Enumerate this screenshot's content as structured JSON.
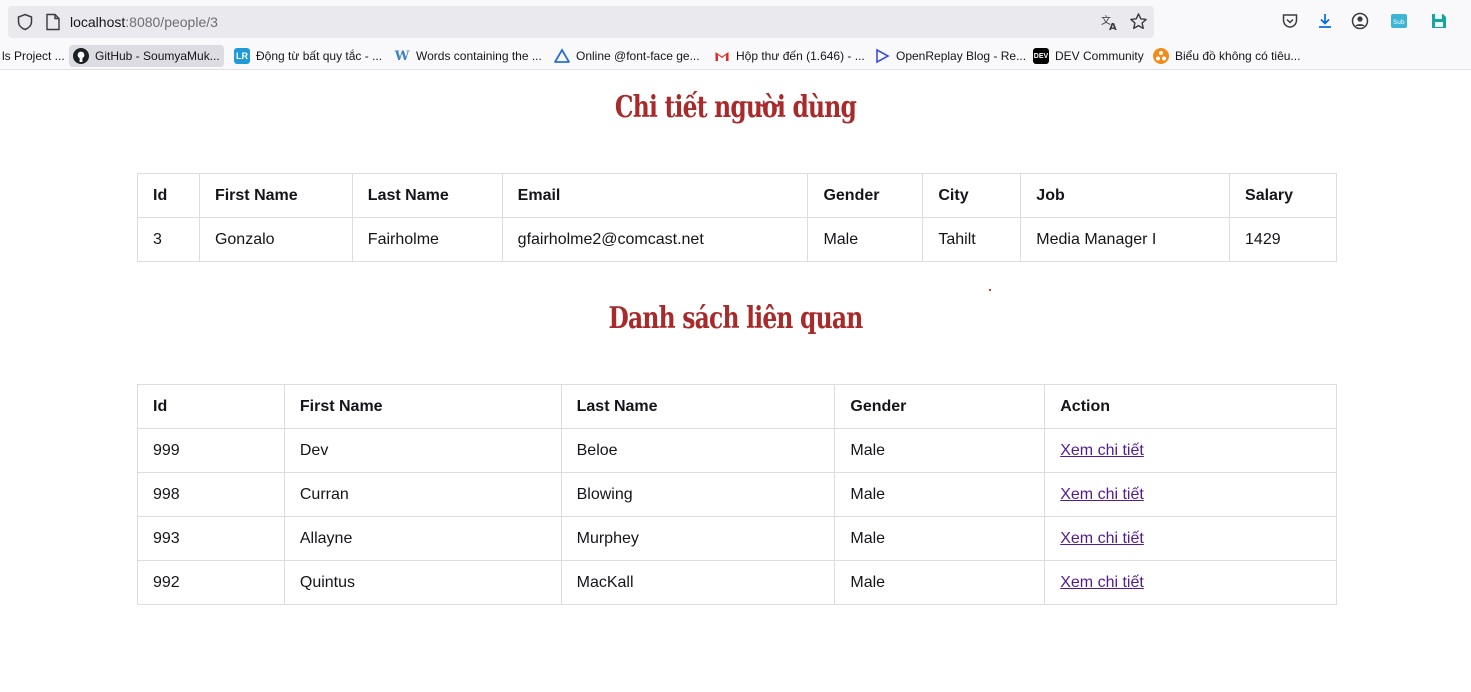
{
  "browser": {
    "url_host": "localhost",
    "url_path": ":8080/people/3",
    "bookmarks": [
      {
        "label": "ls Project ...",
        "icon": "project-icon"
      },
      {
        "label": "GitHub - SoumyaMuk...",
        "icon": "github-icon"
      },
      {
        "label": "Động từ bất quy tắc - ...",
        "icon": "lr-icon"
      },
      {
        "label": "Words containing the ...",
        "icon": "w-icon"
      },
      {
        "label": "Online @font-face ge...",
        "icon": "triangle-icon"
      },
      {
        "label": "Hộp thư đến (1.646) - ...",
        "icon": "gmail-icon"
      },
      {
        "label": "OpenReplay Blog - Re...",
        "icon": "openreplay-icon"
      },
      {
        "label": "DEV Community",
        "icon": "dev-icon"
      },
      {
        "label": "Biểu đồ không có tiêu...",
        "icon": "chart-icon"
      }
    ]
  },
  "detail": {
    "title": "Chi tiết người dùng",
    "headers": [
      "Id",
      "First Name",
      "Last Name",
      "Email",
      "Gender",
      "City",
      "Job",
      "Salary"
    ],
    "row": [
      "3",
      "Gonzalo",
      "Fairholme",
      "gfairholme2@comcast.net",
      "Male",
      "Tahilt",
      "Media Manager I",
      "1429"
    ]
  },
  "related": {
    "title": "Danh sách liên quan",
    "headers": [
      "Id",
      "First Name",
      "Last Name",
      "Gender",
      "Action"
    ],
    "rows": [
      [
        "999",
        "Dev",
        "Beloe",
        "Male",
        "Xem chi tiết"
      ],
      [
        "998",
        "Curran",
        "Blowing",
        "Male",
        "Xem chi tiết"
      ],
      [
        "993",
        "Allayne",
        "Murphey",
        "Male",
        "Xem chi tiết"
      ],
      [
        "992",
        "Quintus",
        "MacKall",
        "Male",
        "Xem chi tiết"
      ]
    ]
  },
  "colors": {
    "heading": "#a82a2a",
    "link": "#551a8b",
    "border": "#dddddd"
  }
}
